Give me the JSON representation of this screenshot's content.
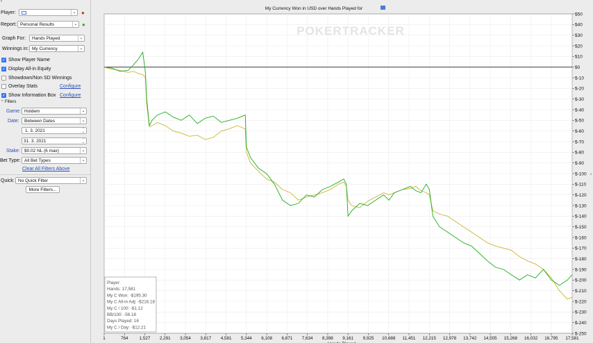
{
  "sidebar": {
    "player_label": "Player:",
    "player_value": "",
    "report_label": "Report:",
    "report_value": "Personal Results",
    "graph_for_label": "Graph For:",
    "graph_for_value": "Hands Played",
    "winnings_in_label": "Winnings in:",
    "winnings_in_value": "My Currency",
    "options": [
      {
        "label": "Show Player Name",
        "checked": true
      },
      {
        "label": "Display All-in Equity",
        "checked": true
      },
      {
        "label": "Showdown/Non SD Winnings",
        "checked": false
      },
      {
        "label": "Overlay Stats",
        "checked": false
      },
      {
        "label": "Show Information Box",
        "checked": true
      }
    ],
    "configure_label": "Configure",
    "filters_label": "Filters",
    "game_label": "Game:",
    "game_value": "Holdem",
    "date_label": "Date:",
    "date_value": "Between Dates",
    "date_from": "1. 3. 2021",
    "date_to": "31. 3. 2021",
    "stake_label": "Stake:",
    "stake_value": "$0.02 NL (6 max)",
    "bet_type_label": "Bet Type:",
    "bet_type_value": "All Bet Types",
    "clear_filters_label": "Clear All Filters Above",
    "quick_label": "Quick:",
    "quick_value": "No Quick Filter",
    "more_filters_label": "More Filters..."
  },
  "chart_data": {
    "type": "line",
    "title": "My Currency Won in USD over Hands Played for",
    "watermark": "POKERTRACKER",
    "xlabel": "Hands Played",
    "ylabel": "",
    "x_ticks": [
      1,
      764,
      1527,
      2291,
      3054,
      3817,
      4581,
      5344,
      6108,
      6871,
      7634,
      8398,
      9161,
      9925,
      10688,
      11451,
      12215,
      12978,
      13742,
      14505,
      15268,
      16032,
      16795,
      17581
    ],
    "x_tick_labels": [
      "1",
      "764",
      "1,527",
      "2,291",
      "3,054",
      "3,817",
      "4,581",
      "5,344",
      "6,108",
      "6,871",
      "7,634",
      "8,398",
      "9,161",
      "9,925",
      "10,688",
      "11,451",
      "12,215",
      "12,978",
      "13,742",
      "14,505",
      "15,268",
      "16,032",
      "16,795",
      "17,581"
    ],
    "xlim": [
      1,
      17581
    ],
    "ylim": [
      -250,
      50
    ],
    "y_ticks": [
      50,
      40,
      30,
      20,
      10,
      0,
      -10,
      -20,
      -30,
      -40,
      -50,
      -60,
      -70,
      -80,
      -90,
      -100,
      -110,
      -120,
      -130,
      -140,
      -150,
      -160,
      -170,
      -180,
      -190,
      -200,
      -210,
      -220,
      -230,
      -240,
      -250
    ],
    "y_tick_labels": [
      "$50",
      "$40",
      "$30",
      "$20",
      "$10",
      "$0",
      "$-10",
      "$-20",
      "$-30",
      "$-40",
      "$-50",
      "$-60",
      "$-70",
      "$-80",
      "$-90",
      "$-100",
      "$-110",
      "$-120",
      "$-130",
      "$-140",
      "$-150",
      "$-160",
      "$-170",
      "$-180",
      "$-190",
      "$-200",
      "$-210",
      "$-220",
      "$-230",
      "$-240",
      "$-250"
    ],
    "grid": true,
    "series": [
      {
        "key": "won",
        "color": "#1faa1f",
        "x": [
          1,
          300,
          600,
          900,
          1100,
          1300,
          1450,
          1550,
          1600,
          1700,
          1800,
          2000,
          2300,
          2600,
          2900,
          3200,
          3500,
          3800,
          4100,
          4400,
          4700,
          5000,
          5300,
          5344,
          5500,
          5800,
          6100,
          6400,
          6700,
          7000,
          7300,
          7600,
          7900,
          8200,
          8500,
          8800,
          9000,
          9100,
          9161,
          9300,
          9600,
          9900,
          10200,
          10500,
          10700,
          10900,
          11200,
          11500,
          11700,
          11900,
          12100,
          12215,
          12350,
          12600,
          12900,
          13200,
          13500,
          13800,
          14100,
          14400,
          14700,
          15000,
          15300,
          15600,
          15900,
          16200,
          16500,
          16800,
          17100,
          17400,
          17581
        ],
        "y": [
          0,
          -1,
          -4,
          -3,
          2,
          8,
          14,
          -5,
          -30,
          -55,
          -50,
          -45,
          -42,
          -47,
          -50,
          -45,
          -53,
          -48,
          -46,
          -52,
          -50,
          -48,
          -45,
          -75,
          -85,
          -95,
          -100,
          -110,
          -125,
          -130,
          -128,
          -120,
          -122,
          -115,
          -112,
          -108,
          -105,
          -110,
          -140,
          -135,
          -128,
          -130,
          -125,
          -120,
          -125,
          -118,
          -115,
          -112,
          -116,
          -118,
          -110,
          -115,
          -140,
          -150,
          -155,
          -160,
          -165,
          -168,
          -175,
          -182,
          -188,
          -190,
          -195,
          -200,
          -195,
          -198,
          -190,
          -200,
          -205,
          -200,
          -195
        ]
      },
      {
        "key": "allin_adj",
        "color": "#c9b530",
        "x": [
          1,
          300,
          600,
          900,
          1100,
          1300,
          1450,
          1550,
          1600,
          1700,
          1800,
          2000,
          2300,
          2600,
          2900,
          3200,
          3500,
          3800,
          4100,
          4400,
          4700,
          5000,
          5300,
          5344,
          5500,
          5800,
          6100,
          6400,
          6700,
          7000,
          7300,
          7600,
          7900,
          8200,
          8500,
          8800,
          9000,
          9100,
          9161,
          9300,
          9600,
          9900,
          10200,
          10500,
          10700,
          10900,
          11200,
          11500,
          11700,
          11900,
          12100,
          12215,
          12350,
          12600,
          12900,
          13200,
          13500,
          13800,
          14100,
          14400,
          14700,
          15000,
          15300,
          15600,
          15900,
          16200,
          16500,
          16800,
          17100,
          17400,
          17581
        ],
        "y": [
          0,
          -2,
          -3,
          -5,
          -4,
          -6,
          -7,
          -10,
          -35,
          -56,
          -55,
          -52,
          -55,
          -60,
          -62,
          -65,
          -64,
          -68,
          -66,
          -60,
          -58,
          -55,
          -58,
          -80,
          -90,
          -98,
          -105,
          -108,
          -115,
          -118,
          -125,
          -122,
          -120,
          -118,
          -115,
          -110,
          -108,
          -112,
          -125,
          -130,
          -132,
          -126,
          -122,
          -118,
          -120,
          -118,
          -115,
          -114,
          -112,
          -116,
          -118,
          -120,
          -135,
          -138,
          -140,
          -145,
          -150,
          -155,
          -160,
          -165,
          -168,
          -170,
          -172,
          -178,
          -182,
          -185,
          -190,
          -198,
          -210,
          -218,
          -216
        ]
      }
    ],
    "info_box": {
      "lines": [
        "Player:",
        "Hands: 17,581",
        "My C Won: -$195.30",
        "My C All-in Adj: -$216.18",
        "My C / 100: -$1.12",
        "BB/100: -56.18",
        "Days Played: 16",
        "My C / Day: -$12.21"
      ]
    }
  }
}
